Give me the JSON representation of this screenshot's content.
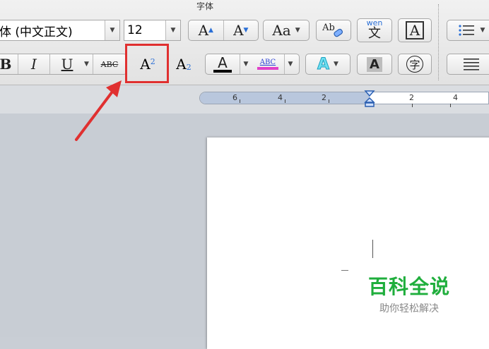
{
  "ribbon": {
    "group_title": "字体",
    "font_name": "体 (中文正文)",
    "font_size": "12",
    "grow_font": "A",
    "shrink_font": "A",
    "change_case": "Aa",
    "clear_format": "Ab",
    "phonetic_top": "wen",
    "phonetic_char": "文",
    "char_border": "A",
    "bold": "B",
    "italic": "I",
    "underline": "U",
    "strikethrough": "ABC",
    "superscript_base": "A",
    "superscript_exp": "2",
    "subscript_base": "A",
    "subscript_exp": "2",
    "font_color": "A",
    "highlight": "ABC",
    "text_effect": "A",
    "char_shading": "A",
    "enclose_char": "字"
  },
  "ruler": {
    "labels": [
      "6",
      "4",
      "2",
      "2",
      "4"
    ]
  },
  "watermark": {
    "main": "百科全说",
    "sub": "助你轻松解决"
  },
  "colors": {
    "highlight_box": "#e03030",
    "arrow": "#e03030",
    "watermark_green": "#1fae3c",
    "highlight_bar": "#e040c8"
  }
}
